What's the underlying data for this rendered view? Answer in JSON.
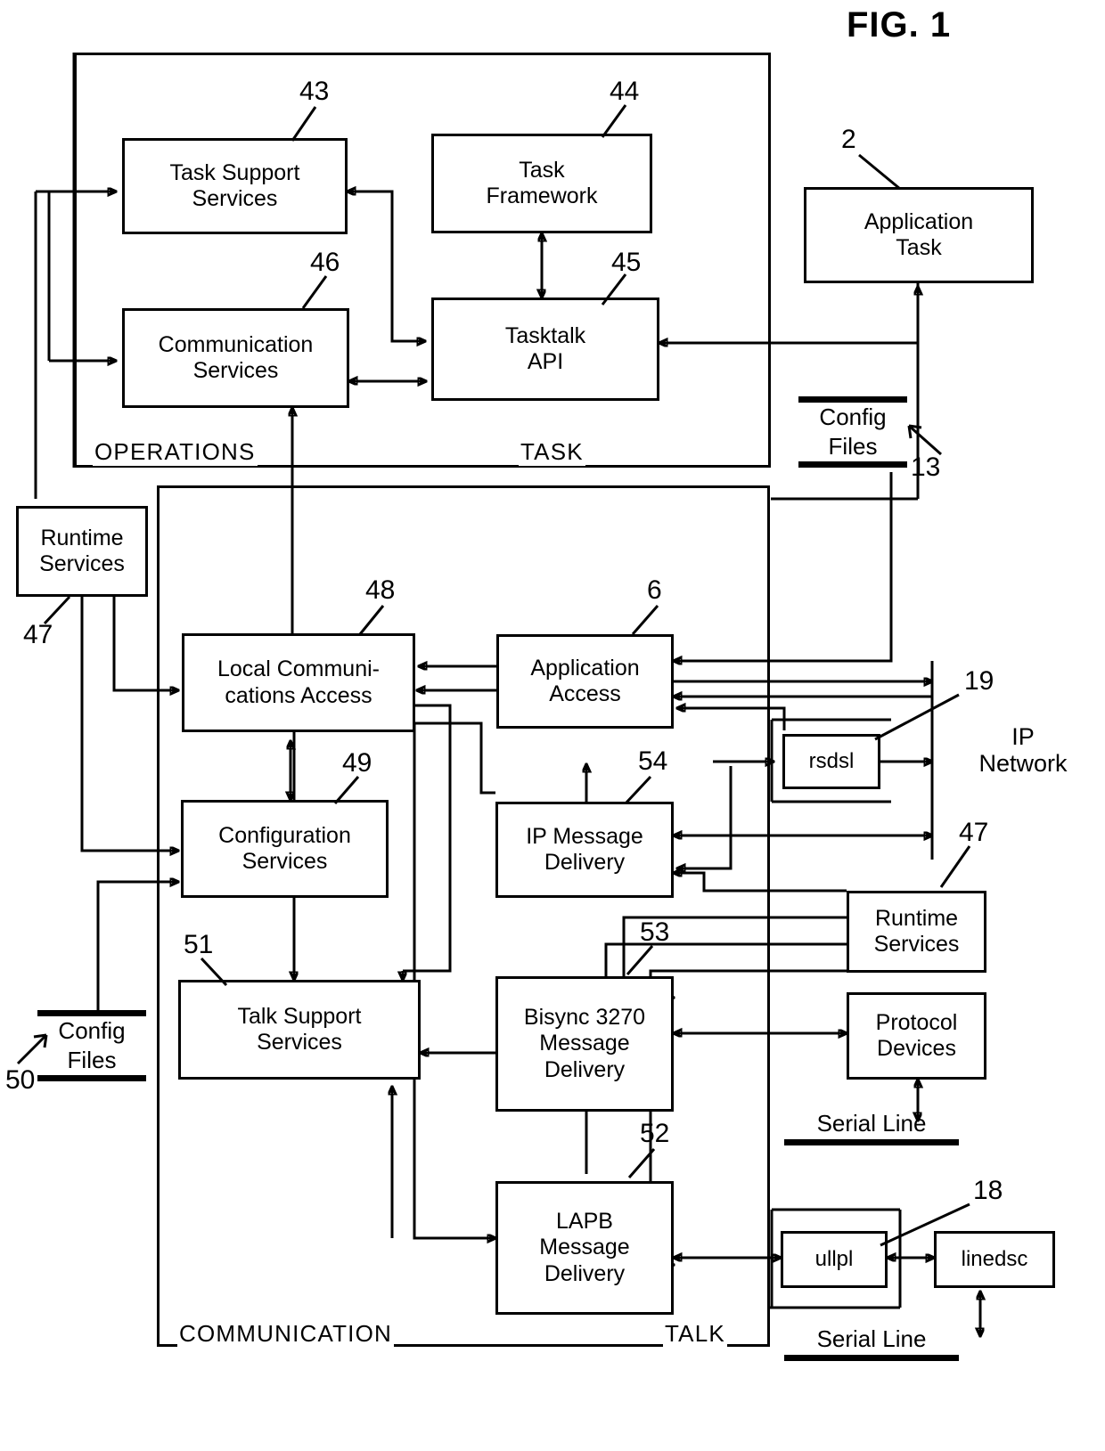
{
  "figure": {
    "title": "FIG. 1"
  },
  "panels": [
    {
      "id": "operations",
      "label": "OPERATIONS"
    },
    {
      "id": "task",
      "label": "TASK"
    },
    {
      "id": "communication",
      "label": "COMMUNICATION"
    },
    {
      "id": "talk",
      "label": "TALK"
    }
  ],
  "boxes": [
    {
      "id": "task-support-services",
      "label": "Task Support\nServices"
    },
    {
      "id": "task-framework",
      "label": "Task\nFramework"
    },
    {
      "id": "application-task",
      "label": "Application\nTask"
    },
    {
      "id": "communication-services",
      "label": "Communication\nServices"
    },
    {
      "id": "tasktalk-api",
      "label": "Tasktalk\nAPI"
    },
    {
      "id": "runtime-services-top",
      "label": "Runtime\nServices"
    },
    {
      "id": "local-communications-access",
      "label": "Local Communi-\ncations Access"
    },
    {
      "id": "application-access",
      "label": "Application\nAccess"
    },
    {
      "id": "rsdsl",
      "label": "rsdsl"
    },
    {
      "id": "configuration-services",
      "label": "Configuration\nServices"
    },
    {
      "id": "ip-message-delivery",
      "label": "IP Message\nDelivery"
    },
    {
      "id": "runtime-services-bottom",
      "label": "Runtime\nServices"
    },
    {
      "id": "talk-support-services",
      "label": "Talk Support\nServices"
    },
    {
      "id": "bisync-message-delivery",
      "label": "Bisync 3270\nMessage\nDelivery"
    },
    {
      "id": "protocol-devices",
      "label": "Protocol\nDevices"
    },
    {
      "id": "lapb-message-delivery",
      "label": "LAPB\nMessage\nDelivery"
    },
    {
      "id": "ullpl",
      "label": "ullpl"
    },
    {
      "id": "linedsc",
      "label": "linedsc"
    }
  ],
  "config_files": [
    {
      "id": "config-files-13",
      "line1": "Config",
      "line2": "Files"
    },
    {
      "id": "config-files-50",
      "line1": "Config",
      "line2": "Files"
    }
  ],
  "serial_lines": [
    {
      "id": "serial-line-upper",
      "label": "Serial Line"
    },
    {
      "id": "serial-line-lower",
      "label": "Serial Line"
    }
  ],
  "free_text": [
    {
      "id": "ip-network",
      "label": "IP\nNetwork"
    }
  ],
  "reference_numerals": [
    {
      "id": "ref-43",
      "value": "43"
    },
    {
      "id": "ref-44",
      "value": "44"
    },
    {
      "id": "ref-2",
      "value": "2"
    },
    {
      "id": "ref-46",
      "value": "46"
    },
    {
      "id": "ref-45",
      "value": "45"
    },
    {
      "id": "ref-13",
      "value": "13"
    },
    {
      "id": "ref-47-top",
      "value": "47"
    },
    {
      "id": "ref-48",
      "value": "48"
    },
    {
      "id": "ref-6",
      "value": "6"
    },
    {
      "id": "ref-19",
      "value": "19"
    },
    {
      "id": "ref-49",
      "value": "49"
    },
    {
      "id": "ref-54",
      "value": "54"
    },
    {
      "id": "ref-47-right",
      "value": "47"
    },
    {
      "id": "ref-51",
      "value": "51"
    },
    {
      "id": "ref-53",
      "value": "53"
    },
    {
      "id": "ref-50",
      "value": "50"
    },
    {
      "id": "ref-52",
      "value": "52"
    },
    {
      "id": "ref-18",
      "value": "18"
    }
  ],
  "colors": {
    "ink": "#000000",
    "paper": "#ffffff"
  }
}
